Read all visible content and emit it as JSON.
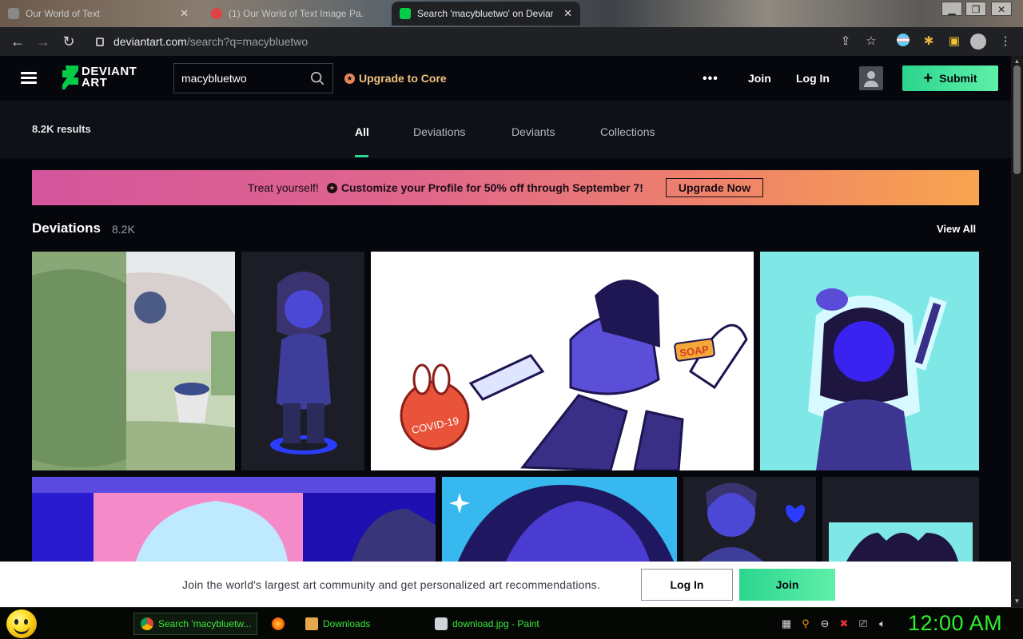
{
  "browser": {
    "tabs": [
      {
        "title": "Our World of Text",
        "active": false
      },
      {
        "title": "(1) Our World of Text Image Pa...",
        "active": false
      },
      {
        "title": "Search 'macybluetwo' on Deviant",
        "active": true
      }
    ],
    "url_host": "deviantart.com",
    "url_path": "/search?q=macybluetwo"
  },
  "header": {
    "logo_line1": "DEVIANT",
    "logo_line2": "ART",
    "search_value": "macybluetwo",
    "upgrade_label": "Upgrade to Core",
    "more_label": "•••",
    "join_label": "Join",
    "login_label": "Log In",
    "submit_label": "Submit"
  },
  "results": {
    "count": "8.2K results",
    "tabs": [
      "All",
      "Deviations",
      "Deviants",
      "Collections"
    ],
    "active_tab": "All"
  },
  "promo": {
    "lead": "Treat yourself!",
    "message": "Customize your Profile for 50% off through September 7!",
    "button": "Upgrade Now"
  },
  "deviations": {
    "title": "Deviations",
    "count": "8.2K",
    "view_all": "View All",
    "image_text": {
      "virus_label": "COVID-19",
      "soap_label": "SOAP"
    }
  },
  "signup": {
    "text": "Join the world's largest art community and get personalized art recommendations.",
    "login_label": "Log In",
    "join_label": "Join"
  },
  "taskbar": {
    "tasks": [
      {
        "label": "Search 'macybluetw...",
        "active": true
      },
      {
        "label": "Downloads",
        "active": false
      },
      {
        "label": "download.jpg - Paint",
        "active": false
      }
    ],
    "clock": "12:00 AM"
  },
  "colors": {
    "accent_green": "#2bd58e",
    "upgrade_gold": "#f2c27d",
    "clock_green": "#2ef02e"
  }
}
